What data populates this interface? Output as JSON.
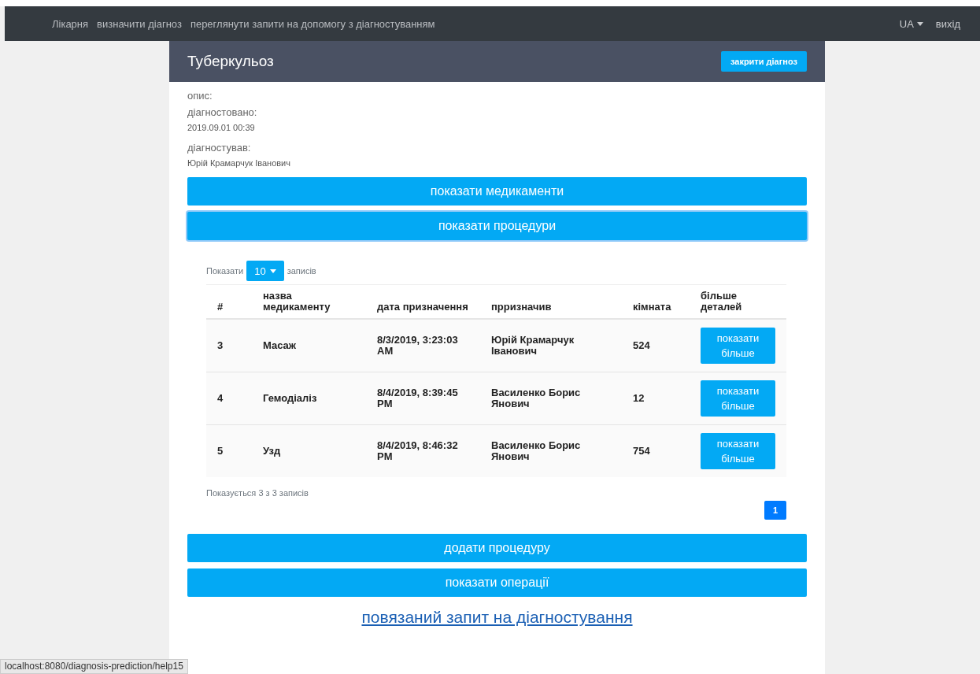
{
  "navbar": {
    "links": [
      "Лікарня",
      "визначити діагноз",
      "переглянути запити на допомогу з діагностуванням"
    ],
    "language": "UA",
    "logout": "вихід"
  },
  "card": {
    "title": "Туберкульоз",
    "close_button": "закрити діагноз",
    "fields": [
      {
        "label": "опис:"
      },
      {
        "label": "діагностовано:",
        "value": "2019.09.01 00:39"
      },
      {
        "label": "діагностував:",
        "value": "Юрій Крамарчук Іванович"
      }
    ],
    "top_buttons": [
      {
        "label": "показати медикаменти",
        "focused": false
      },
      {
        "label": "показати процедури",
        "focused": true
      }
    ],
    "table": {
      "length_prefix": "Показати",
      "length_value": "10",
      "length_suffix": "записів",
      "columns": [
        "#",
        "назва медикаменту",
        "дата призначення",
        "прризначив",
        "кімната",
        "більше деталей"
      ],
      "rows": [
        {
          "cells": [
            "3",
            "Масаж",
            "8/3/2019, 3:23:03 AM",
            "Юрій Крамарчук Іванович",
            "524"
          ],
          "action": "показати більше"
        },
        {
          "cells": [
            "4",
            "Гемодіаліз",
            "8/4/2019, 8:39:45 PM",
            "Василенко Борис Янович",
            "12"
          ],
          "action": "показати більше"
        },
        {
          "cells": [
            "5",
            "Узд",
            "8/4/2019, 8:46:32 PM",
            "Василенко Борис Янович",
            "754"
          ],
          "action": "показати більше"
        }
      ],
      "info": "Показується 3 з 3 записів",
      "pages": [
        {
          "label": "1",
          "selected": true
        }
      ]
    },
    "bottom_buttons": [
      "додати процедуру",
      "показати операції"
    ],
    "link": "повязаний запит на діагностування"
  },
  "status_url": "localhost:8080/diagnosis-prediction/help15"
}
